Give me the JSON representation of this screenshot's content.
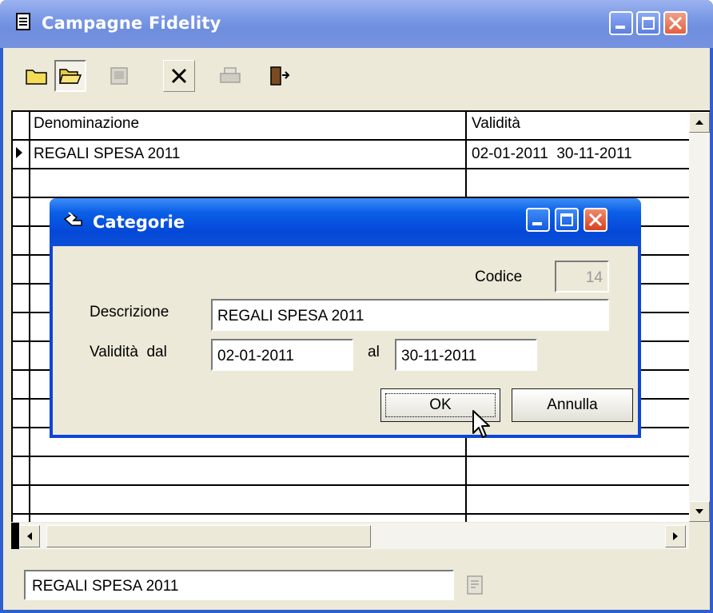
{
  "main_window": {
    "title": "Campagne Fidelity"
  },
  "toolbar": {
    "buttons": [
      "new-folder-icon",
      "open-folder-icon",
      "edit-icon",
      "delete-icon",
      "print-icon",
      "exit-icon"
    ]
  },
  "grid": {
    "columns": [
      "Denominazione",
      "Validità"
    ],
    "rows": [
      {
        "denominazione": "REGALI SPESA 2011",
        "validita": "02-01-2011  30-11-2011"
      }
    ]
  },
  "status": {
    "value": "REGALI SPESA 2011"
  },
  "dialog": {
    "title": "Categorie",
    "codice_label": "Codice",
    "codice_value": "14",
    "descrizione_label": "Descrizione",
    "descrizione_value": "REGALI SPESA 2011",
    "validita_label": "Validità  dal",
    "dal_value": "02-01-2011",
    "al_label": "al",
    "al_value": "30-11-2011",
    "ok_label": "OK",
    "cancel_label": "Annulla"
  },
  "colors": {
    "main_titlebar": "#7c9ae6",
    "dialog_titlebar": "#0548d8",
    "face": "#ece9d8"
  }
}
